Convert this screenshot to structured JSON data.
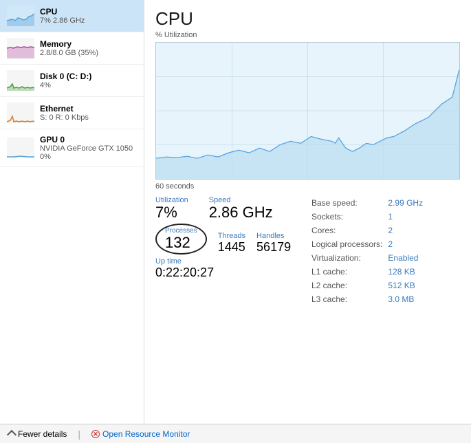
{
  "sidebar": {
    "items": [
      {
        "id": "cpu",
        "title": "CPU",
        "subtitle": "7%  2.86 GHz",
        "active": true,
        "graphColor": "#5ba3d9",
        "graphType": "cpu"
      },
      {
        "id": "memory",
        "title": "Memory",
        "subtitle": "2.8/8.0 GB (35%)",
        "active": false,
        "graphColor": "#b040a0",
        "graphType": "memory"
      },
      {
        "id": "disk",
        "title": "Disk 0 (C: D:)",
        "subtitle": "4%",
        "active": false,
        "graphColor": "#40a040",
        "graphType": "disk"
      },
      {
        "id": "ethernet",
        "title": "Ethernet",
        "subtitle": "S: 0 R: 0 Kbps",
        "active": false,
        "graphColor": "#e07820",
        "graphType": "ethernet"
      },
      {
        "id": "gpu",
        "title": "GPU 0",
        "subtitle": "NVIDIA GeForce GTX 1050\n0%",
        "subtitle1": "NVIDIA GeForce GTX 1050",
        "subtitle2": "0%",
        "active": false,
        "graphColor": "#5ba3d9",
        "graphType": "gpu"
      }
    ]
  },
  "cpu": {
    "title": "CPU",
    "chart_label": "% Utilization",
    "time_label": "60 seconds",
    "utilization_label": "Utilization",
    "utilization_value": "7%",
    "speed_label": "Speed",
    "speed_value": "2.86 GHz",
    "processes_label": "Processes",
    "processes_value": "132",
    "threads_label": "Threads",
    "threads_value": "1445",
    "handles_label": "Handles",
    "handles_value": "56179",
    "uptime_label": "Up time",
    "uptime_value": "0:22:20:27",
    "info": {
      "base_speed_label": "Base speed:",
      "base_speed_value": "2.99 GHz",
      "sockets_label": "Sockets:",
      "sockets_value": "1",
      "cores_label": "Cores:",
      "cores_value": "2",
      "logical_label": "Logical processors:",
      "logical_value": "2",
      "virt_label": "Virtualization:",
      "virt_value": "Enabled",
      "l1_label": "L1 cache:",
      "l1_value": "128 KB",
      "l2_label": "L2 cache:",
      "l2_value": "512 KB",
      "l3_label": "L3 cache:",
      "l3_value": "3.0 MB"
    }
  },
  "bottom_bar": {
    "fewer_details_label": "Fewer details",
    "open_resource_label": "Open Resource Monitor"
  }
}
